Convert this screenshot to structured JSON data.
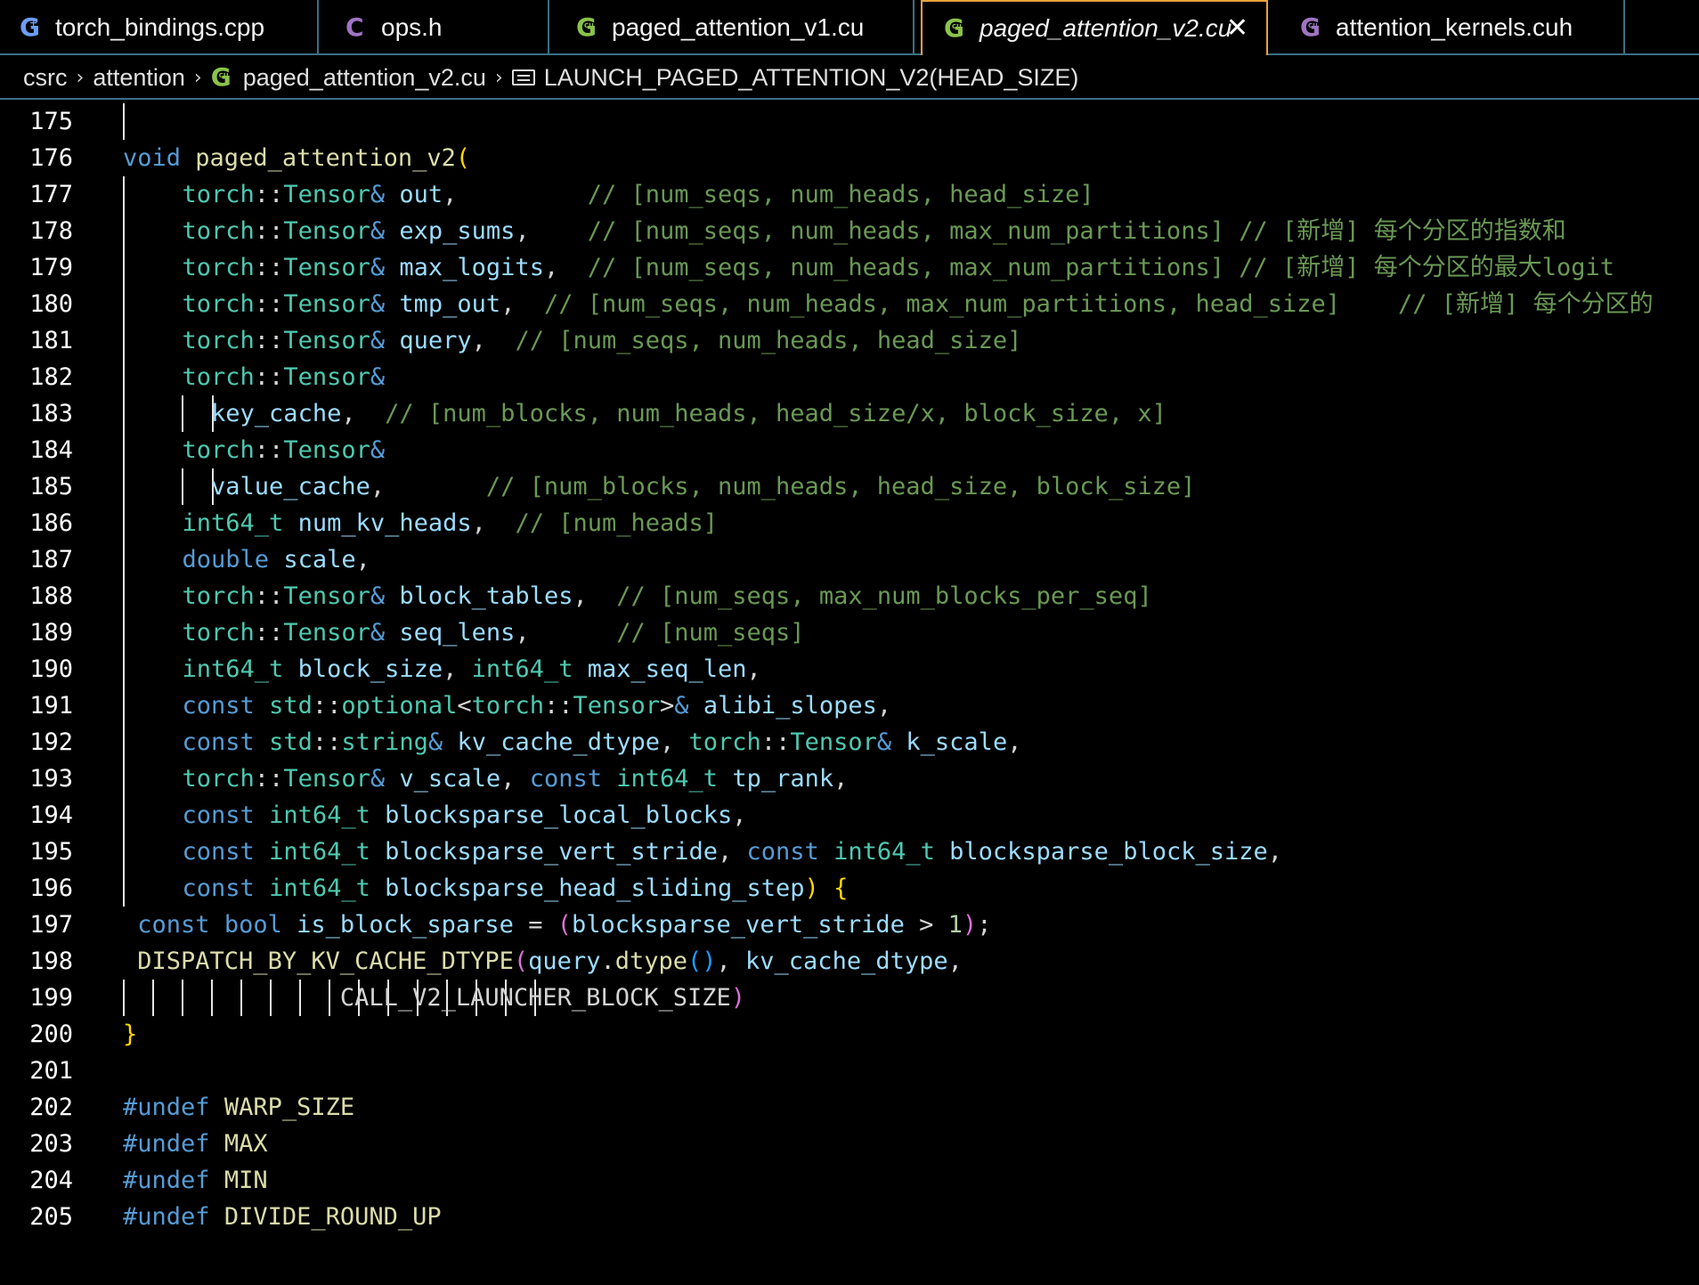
{
  "tabs": [
    {
      "label": "torch_bindings.cpp",
      "icon": "cpp-file-icon",
      "icon_color": "#6c9ef8",
      "active": false
    },
    {
      "label": "ops.h",
      "icon": "c-header-file-icon",
      "icon_color": "#a074c4",
      "active": false
    },
    {
      "label": "paged_attention_v1.cu",
      "icon": "cuda-file-icon",
      "icon_color": "#8bc34a",
      "active": false
    },
    {
      "label": "paged_attention_v2.cu",
      "icon": "cuda-file-icon",
      "icon_color": "#8bc34a",
      "active": true
    },
    {
      "label": "attention_kernels.cuh",
      "icon": "cuda-header-file-icon",
      "icon_color": "#a074c4",
      "active": false
    }
  ],
  "breadcrumb": {
    "items": [
      "csrc",
      "attention",
      "paged_attention_v2.cu",
      "LAUNCH_PAGED_ATTENTION_V2(HEAD_SIZE)"
    ]
  },
  "editor": {
    "accent": "#e8a23a",
    "lines": [
      {
        "n": "175",
        "guides": 1,
        "tokens": []
      },
      {
        "n": "176",
        "guides": 0,
        "tokens": [
          [
            "kw",
            "void"
          ],
          [
            "pn",
            " "
          ],
          [
            "fn",
            "paged_attention_v2"
          ],
          [
            "br1",
            "("
          ]
        ]
      },
      {
        "n": "177",
        "guides": 1,
        "tokens": [
          [
            "pn",
            "  "
          ],
          [
            "ty",
            "torch"
          ],
          [
            "pn",
            "::"
          ],
          [
            "ty",
            "Tensor"
          ],
          [
            "kw",
            "&"
          ],
          [
            "pn",
            " "
          ],
          [
            "pm",
            "out"
          ],
          [
            "pn",
            ",         "
          ],
          [
            "cm",
            "// [num_seqs, num_heads, head_size]"
          ]
        ]
      },
      {
        "n": "178",
        "guides": 1,
        "tokens": [
          [
            "pn",
            "  "
          ],
          [
            "ty",
            "torch"
          ],
          [
            "pn",
            "::"
          ],
          [
            "ty",
            "Tensor"
          ],
          [
            "kw",
            "&"
          ],
          [
            "pn",
            " "
          ],
          [
            "pm",
            "exp_sums"
          ],
          [
            "pn",
            ",    "
          ],
          [
            "cm",
            "// [num_seqs, num_heads, max_num_partitions] // [新增] 每个分区的指数和"
          ]
        ]
      },
      {
        "n": "179",
        "guides": 1,
        "tokens": [
          [
            "pn",
            "  "
          ],
          [
            "ty",
            "torch"
          ],
          [
            "pn",
            "::"
          ],
          [
            "ty",
            "Tensor"
          ],
          [
            "kw",
            "&"
          ],
          [
            "pn",
            " "
          ],
          [
            "pm",
            "max_logits"
          ],
          [
            "pn",
            ",  "
          ],
          [
            "cm",
            "// [num_seqs, num_heads, max_num_partitions] // [新增] 每个分区的最大logit"
          ]
        ]
      },
      {
        "n": "180",
        "guides": 1,
        "tokens": [
          [
            "pn",
            "  "
          ],
          [
            "ty",
            "torch"
          ],
          [
            "pn",
            "::"
          ],
          [
            "ty",
            "Tensor"
          ],
          [
            "kw",
            "&"
          ],
          [
            "pn",
            " "
          ],
          [
            "pm",
            "tmp_out"
          ],
          [
            "pn",
            ",  "
          ],
          [
            "cm",
            "// [num_seqs, num_heads, max_num_partitions, head_size]    // [新增] 每个分区的"
          ]
        ]
      },
      {
        "n": "181",
        "guides": 1,
        "tokens": [
          [
            "pn",
            "  "
          ],
          [
            "ty",
            "torch"
          ],
          [
            "pn",
            "::"
          ],
          [
            "ty",
            "Tensor"
          ],
          [
            "kw",
            "&"
          ],
          [
            "pn",
            " "
          ],
          [
            "pm",
            "query"
          ],
          [
            "pn",
            ",  "
          ],
          [
            "cm",
            "// [num_seqs, num_heads, head_size]"
          ]
        ]
      },
      {
        "n": "182",
        "guides": 1,
        "tokens": [
          [
            "pn",
            "  "
          ],
          [
            "ty",
            "torch"
          ],
          [
            "pn",
            "::"
          ],
          [
            "ty",
            "Tensor"
          ],
          [
            "kw",
            "&"
          ]
        ]
      },
      {
        "n": "183",
        "guides": 3,
        "tokens": [
          [
            "pn",
            "    "
          ],
          [
            "pm",
            "key_cache"
          ],
          [
            "pn",
            ",  "
          ],
          [
            "cm",
            "// [num_blocks, num_heads, head_size/x, block_size, x]"
          ]
        ]
      },
      {
        "n": "184",
        "guides": 1,
        "tokens": [
          [
            "pn",
            "  "
          ],
          [
            "ty",
            "torch"
          ],
          [
            "pn",
            "::"
          ],
          [
            "ty",
            "Tensor"
          ],
          [
            "kw",
            "&"
          ]
        ]
      },
      {
        "n": "185",
        "guides": 3,
        "tokens": [
          [
            "pn",
            "    "
          ],
          [
            "pm",
            "value_cache"
          ],
          [
            "pn",
            ",       "
          ],
          [
            "cm",
            "// [num_blocks, num_heads, head_size, block_size]"
          ]
        ]
      },
      {
        "n": "186",
        "guides": 1,
        "tokens": [
          [
            "pn",
            "  "
          ],
          [
            "ty",
            "int64_t"
          ],
          [
            "pn",
            " "
          ],
          [
            "pm",
            "num_kv_heads"
          ],
          [
            "pn",
            ",  "
          ],
          [
            "cm",
            "// [num_heads]"
          ]
        ]
      },
      {
        "n": "187",
        "guides": 1,
        "tokens": [
          [
            "pn",
            "  "
          ],
          [
            "kw",
            "double"
          ],
          [
            "pn",
            " "
          ],
          [
            "pm",
            "scale"
          ],
          [
            "pn",
            ","
          ]
        ]
      },
      {
        "n": "188",
        "guides": 1,
        "tokens": [
          [
            "pn",
            "  "
          ],
          [
            "ty",
            "torch"
          ],
          [
            "pn",
            "::"
          ],
          [
            "ty",
            "Tensor"
          ],
          [
            "kw",
            "&"
          ],
          [
            "pn",
            " "
          ],
          [
            "pm",
            "block_tables"
          ],
          [
            "pn",
            ",  "
          ],
          [
            "cm",
            "// [num_seqs, max_num_blocks_per_seq]"
          ]
        ]
      },
      {
        "n": "189",
        "guides": 1,
        "tokens": [
          [
            "pn",
            "  "
          ],
          [
            "ty",
            "torch"
          ],
          [
            "pn",
            "::"
          ],
          [
            "ty",
            "Tensor"
          ],
          [
            "kw",
            "&"
          ],
          [
            "pn",
            " "
          ],
          [
            "pm",
            "seq_lens"
          ],
          [
            "pn",
            ",      "
          ],
          [
            "cm",
            "// [num_seqs]"
          ]
        ]
      },
      {
        "n": "190",
        "guides": 1,
        "tokens": [
          [
            "pn",
            "  "
          ],
          [
            "ty",
            "int64_t"
          ],
          [
            "pn",
            " "
          ],
          [
            "pm",
            "block_size"
          ],
          [
            "pn",
            ", "
          ],
          [
            "ty",
            "int64_t"
          ],
          [
            "pn",
            " "
          ],
          [
            "pm",
            "max_seq_len"
          ],
          [
            "pn",
            ","
          ]
        ]
      },
      {
        "n": "191",
        "guides": 1,
        "tokens": [
          [
            "pn",
            "  "
          ],
          [
            "kw",
            "const"
          ],
          [
            "pn",
            " "
          ],
          [
            "ty",
            "std"
          ],
          [
            "pn",
            "::"
          ],
          [
            "ty",
            "optional"
          ],
          [
            "pn",
            "<"
          ],
          [
            "ty",
            "torch"
          ],
          [
            "pn",
            "::"
          ],
          [
            "ty",
            "Tensor"
          ],
          [
            "pn",
            ">"
          ],
          [
            "kw",
            "&"
          ],
          [
            "pn",
            " "
          ],
          [
            "pm",
            "alibi_slopes"
          ],
          [
            "pn",
            ","
          ]
        ]
      },
      {
        "n": "192",
        "guides": 1,
        "tokens": [
          [
            "pn",
            "  "
          ],
          [
            "kw",
            "const"
          ],
          [
            "pn",
            " "
          ],
          [
            "ty",
            "std"
          ],
          [
            "pn",
            "::"
          ],
          [
            "ty",
            "string"
          ],
          [
            "kw",
            "&"
          ],
          [
            "pn",
            " "
          ],
          [
            "pm",
            "kv_cache_dtype"
          ],
          [
            "pn",
            ", "
          ],
          [
            "ty",
            "torch"
          ],
          [
            "pn",
            "::"
          ],
          [
            "ty",
            "Tensor"
          ],
          [
            "kw",
            "&"
          ],
          [
            "pn",
            " "
          ],
          [
            "pm",
            "k_scale"
          ],
          [
            "pn",
            ","
          ]
        ]
      },
      {
        "n": "193",
        "guides": 1,
        "tokens": [
          [
            "pn",
            "  "
          ],
          [
            "ty",
            "torch"
          ],
          [
            "pn",
            "::"
          ],
          [
            "ty",
            "Tensor"
          ],
          [
            "kw",
            "&"
          ],
          [
            "pn",
            " "
          ],
          [
            "pm",
            "v_scale"
          ],
          [
            "pn",
            ", "
          ],
          [
            "kw",
            "const"
          ],
          [
            "pn",
            " "
          ],
          [
            "ty",
            "int64_t"
          ],
          [
            "pn",
            " "
          ],
          [
            "pm",
            "tp_rank"
          ],
          [
            "pn",
            ","
          ]
        ]
      },
      {
        "n": "194",
        "guides": 1,
        "tokens": [
          [
            "pn",
            "  "
          ],
          [
            "kw",
            "const"
          ],
          [
            "pn",
            " "
          ],
          [
            "ty",
            "int64_t"
          ],
          [
            "pn",
            " "
          ],
          [
            "pm",
            "blocksparse_local_blocks"
          ],
          [
            "pn",
            ","
          ]
        ]
      },
      {
        "n": "195",
        "guides": 1,
        "tokens": [
          [
            "pn",
            "  "
          ],
          [
            "kw",
            "const"
          ],
          [
            "pn",
            " "
          ],
          [
            "ty",
            "int64_t"
          ],
          [
            "pn",
            " "
          ],
          [
            "pm",
            "blocksparse_vert_stride"
          ],
          [
            "pn",
            ", "
          ],
          [
            "kw",
            "const"
          ],
          [
            "pn",
            " "
          ],
          [
            "ty",
            "int64_t"
          ],
          [
            "pn",
            " "
          ],
          [
            "pm",
            "blocksparse_block_size"
          ],
          [
            "pn",
            ","
          ]
        ]
      },
      {
        "n": "196",
        "guides": 1,
        "tokens": [
          [
            "pn",
            "  "
          ],
          [
            "kw",
            "const"
          ],
          [
            "pn",
            " "
          ],
          [
            "ty",
            "int64_t"
          ],
          [
            "pn",
            " "
          ],
          [
            "pm",
            "blocksparse_head_sliding_step"
          ],
          [
            "br1",
            ")"
          ],
          [
            "pn",
            " "
          ],
          [
            "br1",
            "{"
          ]
        ]
      },
      {
        "n": "197",
        "guides": 0,
        "tokens": [
          [
            "pn",
            " "
          ],
          [
            "kw",
            "const"
          ],
          [
            "pn",
            " "
          ],
          [
            "kw",
            "bool"
          ],
          [
            "pn",
            " "
          ],
          [
            "pm",
            "is_block_sparse"
          ],
          [
            "pn",
            " = "
          ],
          [
            "br2",
            "("
          ],
          [
            "pm",
            "blocksparse_vert_stride"
          ],
          [
            "pn",
            " > "
          ],
          [
            "nu",
            "1"
          ],
          [
            "br2",
            ")"
          ],
          [
            "pn",
            ";"
          ]
        ]
      },
      {
        "n": "198",
        "guides": 0,
        "tokens": [
          [
            "pn",
            " "
          ],
          [
            "fn",
            "DISPATCH_BY_KV_CACHE_DTYPE"
          ],
          [
            "br2",
            "("
          ],
          [
            "pm",
            "query"
          ],
          [
            "pn",
            "."
          ],
          [
            "fn",
            "dtype"
          ],
          [
            "br3",
            "()"
          ],
          [
            "pn",
            ", "
          ],
          [
            "pm",
            "kv_cache_dtype"
          ],
          [
            "pn",
            ","
          ]
        ]
      },
      {
        "n": "199",
        "guides": 15,
        "tokens": [
          [
            "pn",
            "               "
          ],
          [
            "pn",
            "CALL_V2_LAUNCHER_BLOCK_SIZE"
          ],
          [
            "br2",
            ")"
          ]
        ]
      },
      {
        "n": "200",
        "guides": 0,
        "tokens": [
          [
            "br1",
            "}"
          ]
        ]
      },
      {
        "n": "201",
        "guides": 0,
        "tokens": []
      },
      {
        "n": "202",
        "guides": 0,
        "tokens": [
          [
            "mc2",
            "#undef"
          ],
          [
            "pn",
            " "
          ],
          [
            "fn",
            "WARP_SIZE"
          ]
        ]
      },
      {
        "n": "203",
        "guides": 0,
        "tokens": [
          [
            "mc2",
            "#undef"
          ],
          [
            "pn",
            " "
          ],
          [
            "fn",
            "MAX"
          ]
        ]
      },
      {
        "n": "204",
        "guides": 0,
        "tokens": [
          [
            "mc2",
            "#undef"
          ],
          [
            "pn",
            " "
          ],
          [
            "fn",
            "MIN"
          ]
        ]
      },
      {
        "n": "205",
        "guides": 0,
        "tokens": [
          [
            "mc2",
            "#undef"
          ],
          [
            "pn",
            " "
          ],
          [
            "fn",
            "DIVIDE_ROUND_UP"
          ]
        ]
      }
    ]
  }
}
